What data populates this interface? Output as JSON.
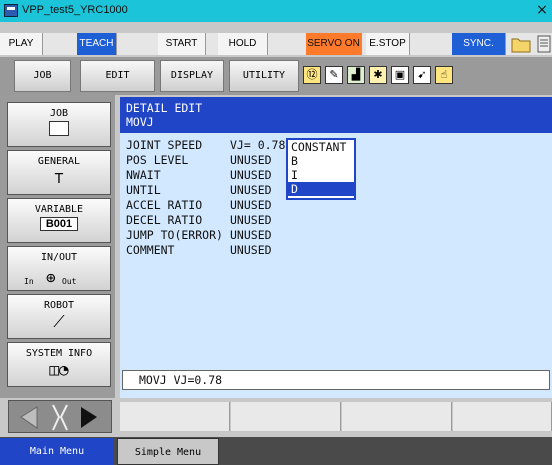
{
  "window": {
    "title": "VPP_test5_YRC1000",
    "close_glyph": "×"
  },
  "toolbar": {
    "play": "PLAY",
    "teach": "TEACH",
    "start": "START",
    "hold": "HOLD",
    "servo_on": "SERVO ON",
    "estop": "E.STOP",
    "sync": "SYNC."
  },
  "menu": {
    "job": "JOB",
    "edit": "EDIT",
    "display": "DISPLAY",
    "utility": "UTILITY"
  },
  "status_icons": [
    "12-icon",
    "edit-icon",
    "chart-icon",
    "robot-icon",
    "io-icon",
    "pointer-icon",
    "hand-icon"
  ],
  "side_menu": [
    {
      "label": "JOB",
      "icon": "job-icon"
    },
    {
      "label": "GENERAL",
      "icon": "tool-icon"
    },
    {
      "label": "VARIABLE",
      "sub": "B001"
    },
    {
      "label": "IN/OUT",
      "icon": "inout-icon",
      "in_text": "In",
      "out_text": "Out"
    },
    {
      "label": "ROBOT",
      "icon": "robot-arm-icon"
    },
    {
      "label": "SYSTEM INFO",
      "icon": "system-info-icon"
    }
  ],
  "detail": {
    "header": "DETAIL EDIT",
    "instruction": "MOVJ",
    "rows": [
      {
        "name": "JOINT SPEED",
        "value": "VJ= 0.78"
      },
      {
        "name": "POS LEVEL",
        "value": "UNUSED"
      },
      {
        "name": "NWAIT",
        "value": "UNUSED"
      },
      {
        "name": "UNTIL",
        "value": "UNUSED"
      },
      {
        "name": "ACCEL RATIO",
        "value": "UNUSED"
      },
      {
        "name": "DECEL RATIO",
        "value": "UNUSED"
      },
      {
        "name": "JUMP TO(ERROR)",
        "value": "UNUSED"
      },
      {
        "name": "COMMENT",
        "value": "UNUSED"
      }
    ],
    "popup_options": [
      "CONSTANT",
      "B",
      "I",
      "D"
    ],
    "popup_selected": "D"
  },
  "input_line": "MOVJ VJ=0.78",
  "footer": {
    "main_menu": "Main Menu",
    "simple_menu": "Simple Menu"
  },
  "colors": {
    "header_blue": "#2045c6",
    "area_bg": "#d2e8ff",
    "teach_blue": "#1f5fd6",
    "servo_orange": "#ff7a2a"
  }
}
